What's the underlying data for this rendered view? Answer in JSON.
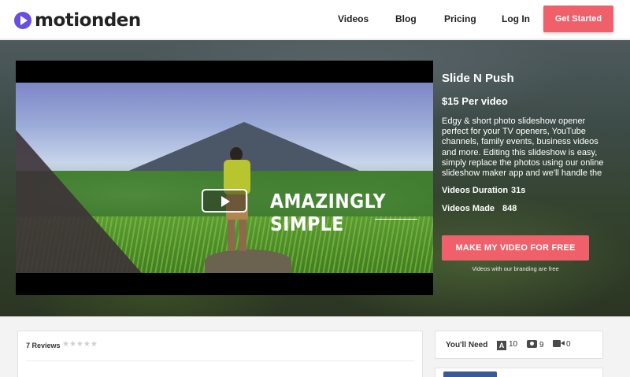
{
  "brand": {
    "name": "motionden",
    "color": "#6a4fdc"
  },
  "nav": {
    "items": [
      {
        "label": "Videos"
      },
      {
        "label": "Blog"
      },
      {
        "label": "Pricing"
      },
      {
        "label": "Log In"
      }
    ],
    "cta_label": "Get Started"
  },
  "accent_color": "#f0606a",
  "player": {
    "overlay_text": "AMAZINGLY SIMPLE",
    "play_icon": "play-icon"
  },
  "product": {
    "title": "Slide N Push",
    "price": "$15 Per video",
    "description": "Edgy & short photo slideshow opener perfect for your TV openers, YouTube channels, family events, business videos and more. Editing this slideshow is easy, simply replace the photos using our online slideshow maker app and we'll handle the",
    "duration_label": "Videos Duration",
    "duration_value": "31s",
    "made_label": "Videos Made",
    "made_value": "848",
    "make_button": "MAKE MY VIDEO FOR FREE",
    "branding_note": "Videos with our branding are free"
  },
  "reviews": {
    "heading": "7 Reviews",
    "rating_stars": 0,
    "stars_text": "★★★★★"
  },
  "needs": {
    "label": "You'll Need",
    "text_icon": "A",
    "text_count": "10",
    "photo_count": "9",
    "video_count": "0"
  }
}
